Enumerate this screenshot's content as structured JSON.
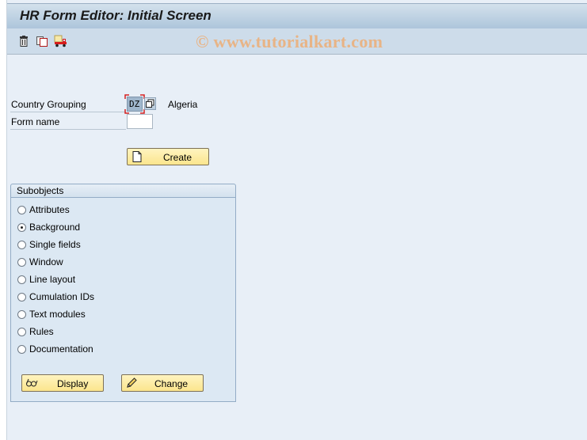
{
  "window": {
    "title": "HR Form Editor: Initial Screen"
  },
  "toolbar": {
    "icons": [
      {
        "name": "delete",
        "icon": "trash-icon"
      },
      {
        "name": "copy",
        "icon": "copy-icon"
      },
      {
        "name": "transport",
        "icon": "truck-icon"
      }
    ],
    "watermark": "© www.tutorialkart.com"
  },
  "form": {
    "country_grouping": {
      "label": "Country Grouping",
      "value": "DZ",
      "description": "Algeria"
    },
    "form_name": {
      "label": "Form name",
      "value": ""
    },
    "create_button": "Create"
  },
  "subobjects": {
    "title": "Subobjects",
    "options": [
      {
        "label": "Attributes",
        "checked": false
      },
      {
        "label": "Background",
        "checked": true
      },
      {
        "label": "Single fields",
        "checked": false
      },
      {
        "label": "Window",
        "checked": false
      },
      {
        "label": "Line layout",
        "checked": false
      },
      {
        "label": "Cumulation IDs",
        "checked": false
      },
      {
        "label": "Text modules",
        "checked": false
      },
      {
        "label": "Rules",
        "checked": false
      },
      {
        "label": "Documentation",
        "checked": false
      }
    ],
    "display_button": "Display",
    "change_button": "Change"
  }
}
